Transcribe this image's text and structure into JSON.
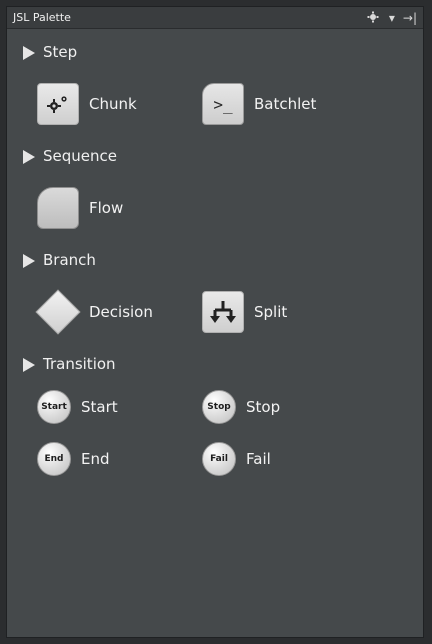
{
  "panel": {
    "title": "JSL Palette",
    "gear_icon": "gear-icon",
    "gear_caret": "▾",
    "pin_icon": "pin-icon",
    "pin_glyph": "→|"
  },
  "categories": {
    "step": {
      "label": "Step",
      "items": [
        {
          "label": "Chunk",
          "icon": "gears-icon"
        },
        {
          "label": "Batchlet",
          "icon": "terminal-icon",
          "glyph": ">_"
        }
      ]
    },
    "sequence": {
      "label": "Sequence",
      "items": [
        {
          "label": "Flow",
          "icon": "flow-shape-icon"
        }
      ]
    },
    "branch": {
      "label": "Branch",
      "items": [
        {
          "label": "Decision",
          "icon": "diamond-icon"
        },
        {
          "label": "Split",
          "icon": "split-arrows-icon"
        }
      ]
    },
    "transition": {
      "label": "Transition",
      "items": [
        {
          "label": "Start",
          "badge": "Start"
        },
        {
          "label": "Stop",
          "badge": "Stop"
        },
        {
          "label": "End",
          "badge": "End"
        },
        {
          "label": "Fail",
          "badge": "Fail"
        }
      ]
    }
  }
}
